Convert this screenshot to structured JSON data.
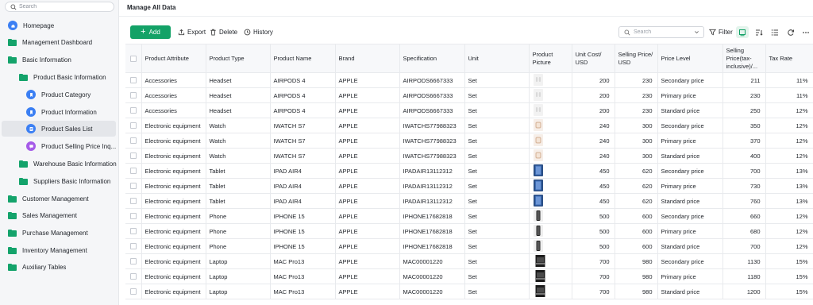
{
  "sidebar": {
    "search_placeholder": "Search",
    "items": [
      {
        "label": "Homepage",
        "name": "sidebar-item-homepage",
        "icon": "home-icon",
        "level": 0,
        "kind": "home"
      },
      {
        "label": "Management Dashboard",
        "name": "sidebar-item-management-dashboard",
        "icon": "folder-icon",
        "level": 0,
        "kind": "folder"
      },
      {
        "label": "Basic Information",
        "name": "sidebar-item-basic-information",
        "icon": "folder-icon",
        "level": 0,
        "kind": "folder"
      },
      {
        "label": "Product Basic Information",
        "name": "sidebar-item-product-basic-information",
        "icon": "folder-icon",
        "level": 1,
        "kind": "folder"
      },
      {
        "label": "Product Category",
        "name": "sidebar-item-product-category",
        "icon": "bookmark-icon",
        "level": 2,
        "kind": "blue"
      },
      {
        "label": "Product Information",
        "name": "sidebar-item-product-information",
        "icon": "bookmark-icon",
        "level": 2,
        "kind": "blue"
      },
      {
        "label": "Product Sales List",
        "name": "sidebar-item-product-sales-list",
        "icon": "list-icon",
        "level": 2,
        "kind": "blue",
        "active": true
      },
      {
        "label": "Product Selling Price Inq...",
        "name": "sidebar-item-product-selling-price-inquiry",
        "icon": "chat-icon",
        "level": 2,
        "kind": "purple"
      },
      {
        "label": "Warehouse Basic Information",
        "name": "sidebar-item-warehouse-basic-information",
        "icon": "folder-icon",
        "level": 1,
        "kind": "folder"
      },
      {
        "label": "Suppliers Basic Information",
        "name": "sidebar-item-suppliers-basic-information",
        "icon": "folder-icon",
        "level": 1,
        "kind": "folder"
      },
      {
        "label": "Customer Management",
        "name": "sidebar-item-customer-management",
        "icon": "folder-icon",
        "level": 0,
        "kind": "folder"
      },
      {
        "label": "Sales Management",
        "name": "sidebar-item-sales-management",
        "icon": "folder-icon",
        "level": 0,
        "kind": "folder"
      },
      {
        "label": "Purchase Management",
        "name": "sidebar-item-purchase-management",
        "icon": "folder-icon",
        "level": 0,
        "kind": "folder"
      },
      {
        "label": "Inventory Management",
        "name": "sidebar-item-inventory-management",
        "icon": "folder-icon",
        "level": 0,
        "kind": "folder"
      },
      {
        "label": "Auxiliary Tables",
        "name": "sidebar-item-auxiliary-tables",
        "icon": "folder-icon",
        "level": 0,
        "kind": "folder"
      }
    ]
  },
  "header": {
    "title": "Manage All Data"
  },
  "toolbar": {
    "add_label": "Add",
    "export_label": "Export",
    "delete_label": "Delete",
    "history_label": "History",
    "search_placeholder": "Search",
    "filter_label": "Filter"
  },
  "colors": {
    "accent": "#13a267",
    "folder": "#14a36b",
    "icon_blue": "#3b7ff3",
    "icon_purple": "#a55be8"
  },
  "table": {
    "columns": [
      "Product Attribute",
      "Product Type",
      "Product Name",
      "Brand",
      "Specification",
      "Unit",
      "Product Picture",
      "Unit Cost/ USD",
      "Selling Price/ USD",
      "Price Level",
      "Selling Price(tax-inclusive)/...",
      "Tax Rate"
    ],
    "rows": [
      {
        "attr": "Accessories",
        "type": "Headset",
        "name": "AIRPODS 4",
        "brand": "APPLE",
        "spec": "AIRPODS6667333",
        "unit": "Set",
        "pic": "airpods",
        "cost": "200",
        "price": "230",
        "level": "Secondary price",
        "taxprice": "211",
        "tax": "11%"
      },
      {
        "attr": "Accessories",
        "type": "Headset",
        "name": "AIRPODS 4",
        "brand": "APPLE",
        "spec": "AIRPODS6667333",
        "unit": "Set",
        "pic": "airpods",
        "cost": "200",
        "price": "230",
        "level": "Primary price",
        "taxprice": "230",
        "tax": "11%"
      },
      {
        "attr": "Accessories",
        "type": "Headset",
        "name": "AIRPODS 4",
        "brand": "APPLE",
        "spec": "AIRPODS6667333",
        "unit": "Set",
        "pic": "airpods",
        "cost": "200",
        "price": "230",
        "level": "Standard price",
        "taxprice": "250",
        "tax": "12%"
      },
      {
        "attr": "Electronic equipment",
        "type": "Watch",
        "name": "IWATCH S7",
        "brand": "APPLE",
        "spec": "IWATCHS77988323",
        "unit": "Set",
        "pic": "watch",
        "cost": "240",
        "price": "300",
        "level": "Secondary price",
        "taxprice": "350",
        "tax": "12%"
      },
      {
        "attr": "Electronic equipment",
        "type": "Watch",
        "name": "IWATCH S7",
        "brand": "APPLE",
        "spec": "IWATCHS77988323",
        "unit": "Set",
        "pic": "watch",
        "cost": "240",
        "price": "300",
        "level": "Primary price",
        "taxprice": "370",
        "tax": "12%"
      },
      {
        "attr": "Electronic equipment",
        "type": "Watch",
        "name": "IWATCH S7",
        "brand": "APPLE",
        "spec": "IWATCHS77988323",
        "unit": "Set",
        "pic": "watch",
        "cost": "240",
        "price": "300",
        "level": "Standard price",
        "taxprice": "400",
        "tax": "12%"
      },
      {
        "attr": "Electronic equipment",
        "type": "Tablet",
        "name": "IPAD AIR4",
        "brand": "APPLE",
        "spec": "IPADAIR13112312",
        "unit": "Set",
        "pic": "ipad",
        "cost": "450",
        "price": "620",
        "level": "Secondary price",
        "taxprice": "700",
        "tax": "13%"
      },
      {
        "attr": "Electronic equipment",
        "type": "Tablet",
        "name": "IPAD AIR4",
        "brand": "APPLE",
        "spec": "IPADAIR13112312",
        "unit": "Set",
        "pic": "ipad",
        "cost": "450",
        "price": "620",
        "level": "Primary price",
        "taxprice": "730",
        "tax": "13%"
      },
      {
        "attr": "Electronic equipment",
        "type": "Tablet",
        "name": "IPAD AIR4",
        "brand": "APPLE",
        "spec": "IPADAIR13112312",
        "unit": "Set",
        "pic": "ipad",
        "cost": "450",
        "price": "620",
        "level": "Standard price",
        "taxprice": "760",
        "tax": "13%"
      },
      {
        "attr": "Electronic equipment",
        "type": "Phone",
        "name": "IPHONE 15",
        "brand": "APPLE",
        "spec": "IPHONE17682818",
        "unit": "Set",
        "pic": "iphone",
        "cost": "500",
        "price": "600",
        "level": "Secondary price",
        "taxprice": "660",
        "tax": "12%"
      },
      {
        "attr": "Electronic equipment",
        "type": "Phone",
        "name": "IPHONE 15",
        "brand": "APPLE",
        "spec": "IPHONE17682818",
        "unit": "Set",
        "pic": "iphone",
        "cost": "500",
        "price": "600",
        "level": "Primary price",
        "taxprice": "680",
        "tax": "12%"
      },
      {
        "attr": "Electronic equipment",
        "type": "Phone",
        "name": "IPHONE 15",
        "brand": "APPLE",
        "spec": "IPHONE17682818",
        "unit": "Set",
        "pic": "iphone",
        "cost": "500",
        "price": "600",
        "level": "Standard price",
        "taxprice": "700",
        "tax": "12%"
      },
      {
        "attr": "Electronic equipment",
        "type": "Laptop",
        "name": "MAC Pro13",
        "brand": "APPLE",
        "spec": "MAC00001220",
        "unit": "Set",
        "pic": "mac",
        "cost": "700",
        "price": "980",
        "level": "Secondary price",
        "taxprice": "1130",
        "tax": "15%"
      },
      {
        "attr": "Electronic equipment",
        "type": "Laptop",
        "name": "MAC Pro13",
        "brand": "APPLE",
        "spec": "MAC00001220",
        "unit": "Set",
        "pic": "mac",
        "cost": "700",
        "price": "980",
        "level": "Primary price",
        "taxprice": "1180",
        "tax": "15%"
      },
      {
        "attr": "Electronic equipment",
        "type": "Laptop",
        "name": "MAC Pro13",
        "brand": "APPLE",
        "spec": "MAC00001220",
        "unit": "Set",
        "pic": "mac",
        "cost": "700",
        "price": "980",
        "level": "Standard price",
        "taxprice": "1200",
        "tax": "15%"
      }
    ]
  }
}
